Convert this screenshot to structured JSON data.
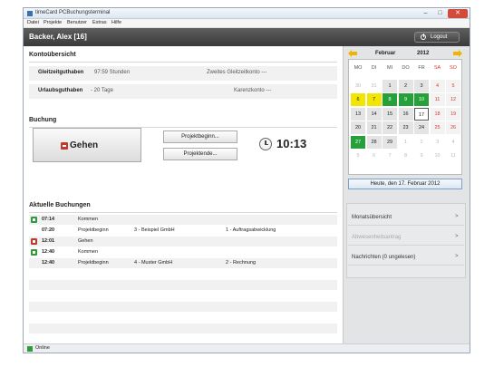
{
  "window": {
    "title": "timeCard PCBuchungsterminal",
    "controls": {
      "minimize": "–",
      "maximize": "□",
      "close": "✕"
    }
  },
  "menu": [
    "Datei",
    "Projekte",
    "Benutzer",
    "Extras",
    "Hilfe"
  ],
  "header": {
    "user": "Backer, Alex [16]",
    "logout_label": "Logout"
  },
  "account": {
    "title": "Kontoübersicht",
    "rows": [
      {
        "label": "Gleitzeitguthaben",
        "value": "97:59 Stunden",
        "right": "Zweites Gleitzeitkonto ---"
      },
      {
        "label": "Urlaubsguthaben",
        "value": "- 20 Tage",
        "right": "Karenzkonto ---"
      }
    ]
  },
  "booking": {
    "title": "Buchung",
    "go_label": "Gehen",
    "project_start": "Projektbeginn...",
    "project_end": "Projektende...",
    "time": "10:13"
  },
  "current": {
    "title": "Aktuelle Buchungen",
    "rows": [
      {
        "type": "in",
        "time": "07:14",
        "action": "Kommen",
        "project": "",
        "task": ""
      },
      {
        "type": "",
        "time": "07:20",
        "action": "Projektbeginn",
        "project": "3 - Beispiel GmbH",
        "task": "1 - Auftragsabwicklung"
      },
      {
        "type": "out",
        "time": "12:01",
        "action": "Gehen",
        "project": "",
        "task": ""
      },
      {
        "type": "in",
        "time": "12:40",
        "action": "Kommen",
        "project": "",
        "task": ""
      },
      {
        "type": "",
        "time": "12:40",
        "action": "Projektbeginn",
        "project": "4 - Muster GmbH",
        "task": "2 - Rechnung"
      }
    ]
  },
  "calendar": {
    "month": "Februar",
    "year": "2012",
    "weekdays": [
      "MO",
      "DI",
      "MI",
      "DO",
      "FR",
      "SA",
      "SO"
    ],
    "weeks": [
      [
        {
          "d": "30",
          "s": "other"
        },
        {
          "d": "31",
          "s": "other"
        },
        {
          "d": "1",
          "s": "weekday"
        },
        {
          "d": "2",
          "s": "weekday"
        },
        {
          "d": "3",
          "s": "weekday"
        },
        {
          "d": "4",
          "s": "weekend"
        },
        {
          "d": "5",
          "s": "weekend"
        }
      ],
      [
        {
          "d": "6",
          "s": "yellow"
        },
        {
          "d": "7",
          "s": "yellow"
        },
        {
          "d": "8",
          "s": "green"
        },
        {
          "d": "9",
          "s": "green"
        },
        {
          "d": "10",
          "s": "green"
        },
        {
          "d": "11",
          "s": "weekend"
        },
        {
          "d": "12",
          "s": "weekend"
        }
      ],
      [
        {
          "d": "13",
          "s": "weekday"
        },
        {
          "d": "14",
          "s": "weekday"
        },
        {
          "d": "15",
          "s": "weekday"
        },
        {
          "d": "16",
          "s": "weekday"
        },
        {
          "d": "17",
          "s": "today"
        },
        {
          "d": "18",
          "s": "weekend"
        },
        {
          "d": "19",
          "s": "weekend"
        }
      ],
      [
        {
          "d": "20",
          "s": "weekday"
        },
        {
          "d": "21",
          "s": "weekday"
        },
        {
          "d": "22",
          "s": "weekday"
        },
        {
          "d": "23",
          "s": "weekday"
        },
        {
          "d": "24",
          "s": "weekday"
        },
        {
          "d": "25",
          "s": "weekend"
        },
        {
          "d": "26",
          "s": "weekend"
        }
      ],
      [
        {
          "d": "27",
          "s": "green"
        },
        {
          "d": "28",
          "s": "weekday"
        },
        {
          "d": "29",
          "s": "weekday"
        },
        {
          "d": "1",
          "s": "other"
        },
        {
          "d": "2",
          "s": "other"
        },
        {
          "d": "3",
          "s": "other"
        },
        {
          "d": "4",
          "s": "other"
        }
      ],
      [
        {
          "d": "5",
          "s": "other"
        },
        {
          "d": "6",
          "s": "other"
        },
        {
          "d": "7",
          "s": "other"
        },
        {
          "d": "8",
          "s": "other"
        },
        {
          "d": "9",
          "s": "other"
        },
        {
          "d": "10",
          "s": "other"
        },
        {
          "d": "11",
          "s": "other"
        }
      ]
    ],
    "today_button": "Heute, den 17. Februar 2012"
  },
  "side_menu": [
    {
      "label": "Monatsübersicht",
      "enabled": true
    },
    {
      "label": "Abwesenheitsantrag",
      "enabled": false
    },
    {
      "label": "Nachrichten (0 ungelesen)",
      "enabled": true
    }
  ],
  "side_arrow": ">",
  "status": {
    "label": "Online"
  },
  "colors": {
    "accent_green": "#26a038",
    "accent_yellow": "#f2e600",
    "stop_red": "#c0392b",
    "header_dark": "#444444"
  }
}
